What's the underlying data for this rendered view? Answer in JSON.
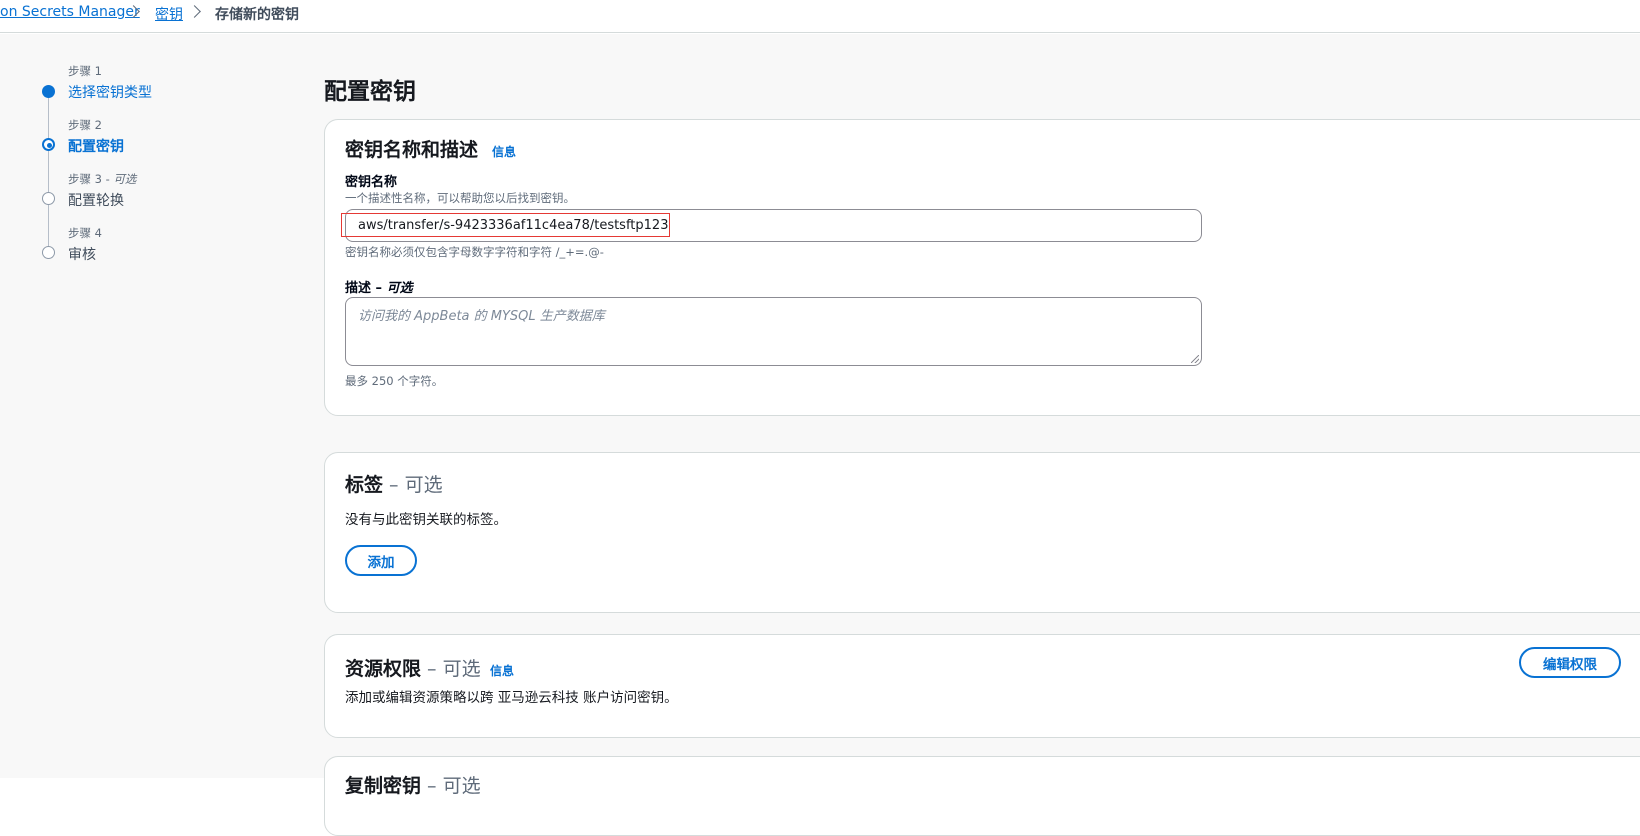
{
  "breadcrumb": {
    "items": [
      "on Secrets Manager",
      "密钥"
    ],
    "current": "存储新的密钥"
  },
  "steps": [
    {
      "num": "步骤 1",
      "title": "选择密钥类型"
    },
    {
      "num": "步骤 2",
      "title": "配置密钥"
    },
    {
      "num": "步骤 3 - ",
      "optional": "可选",
      "title": "配置轮换"
    },
    {
      "num": "步骤 4",
      "title": "审核"
    }
  ],
  "page_title": "配置密钥",
  "name_panel": {
    "title": "密钥名称和描述",
    "info": "信息",
    "name_label": "密钥名称",
    "name_desc": "一个描述性名称，可以帮助您以后找到密钥。",
    "name_value": "aws/transfer/s-9423336af11c4ea78/testsftp123",
    "name_constraint": "密钥名称必须仅包含字母数字字符和字符 /_+=.@-",
    "desc_label": "描述 – ",
    "desc_optional": "可选",
    "desc_placeholder": "访问我的 AppBeta 的 MYSQL 生产数据库",
    "desc_constraint": "最多 250 个字符。"
  },
  "tags_panel": {
    "title": "标签",
    "optional": " – 可选",
    "empty_text": "没有与此密钥关联的标签。",
    "add_label": "添加"
  },
  "perm_panel": {
    "title": "资源权限",
    "optional": " – 可选",
    "info": "信息",
    "text": "添加或编辑资源策略以跨 亚马逊云科技 账户访问密钥。",
    "edit_label": "编辑权限"
  },
  "replicate_panel": {
    "title": "复制密钥",
    "optional": " – 可选"
  }
}
